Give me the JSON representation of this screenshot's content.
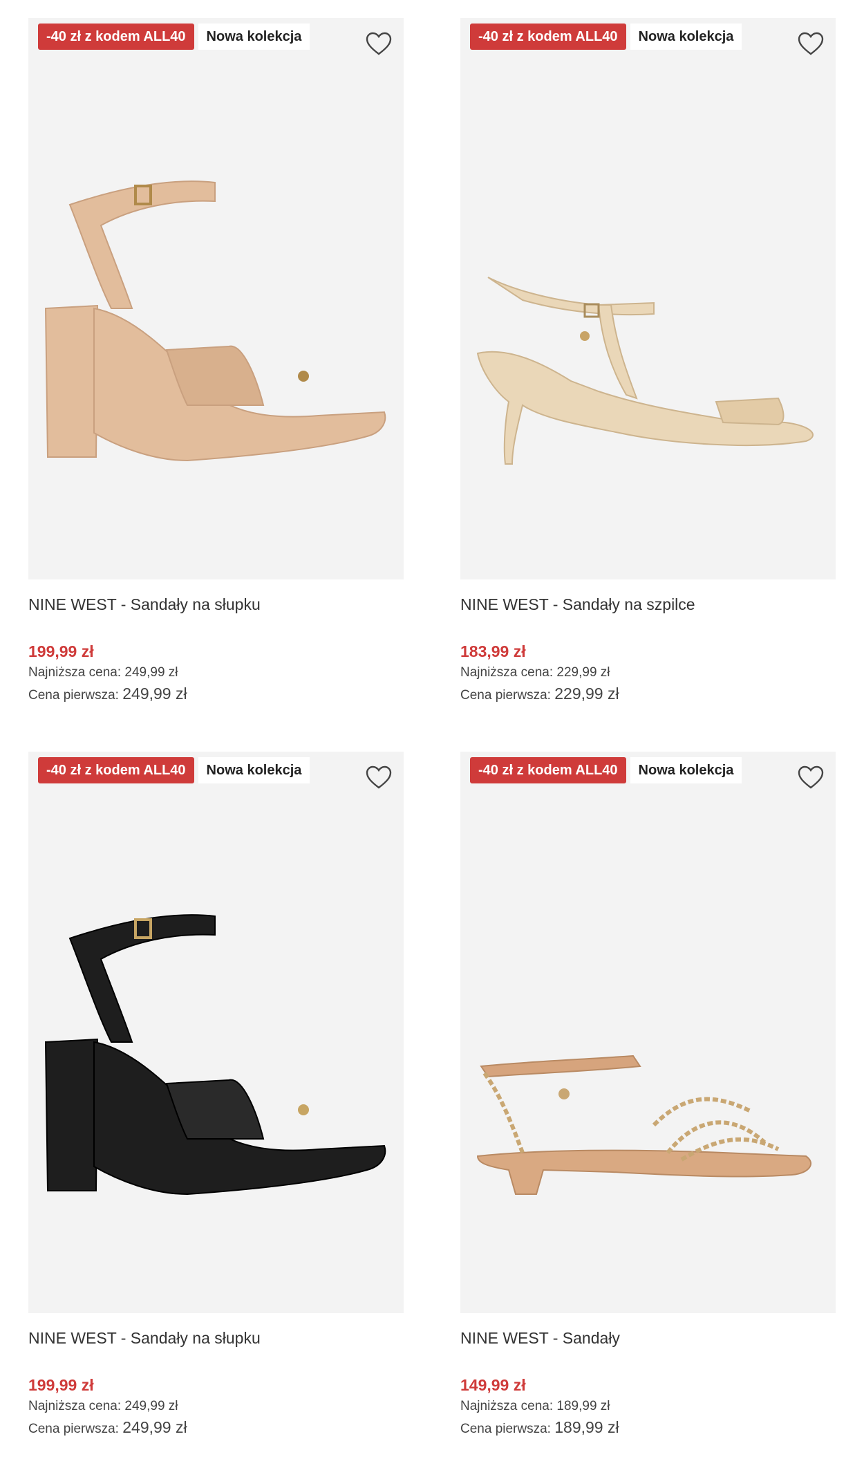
{
  "products": [
    {
      "promo_badge": "-40 zł z kodem ALL40",
      "new_badge": "Nowa kolekcja",
      "title": "NINE WEST - Sandały na słupku",
      "price": "199,99 zł",
      "lowest_label": "Najniższa cena:",
      "lowest_value": "249,99 zł",
      "first_label": "Cena pierwsza:",
      "first_value": "249,99 zł",
      "shoe_color": "#e2bd9c"
    },
    {
      "promo_badge": "-40 zł z kodem ALL40",
      "new_badge": "Nowa kolekcja",
      "title": "NINE WEST - Sandały na szpilce",
      "price": "183,99 zł",
      "lowest_label": "Najniższa cena:",
      "lowest_value": "229,99 zł",
      "first_label": "Cena pierwsza:",
      "first_value": "229,99 zł",
      "shoe_color": "#ead7b8"
    },
    {
      "promo_badge": "-40 zł z kodem ALL40",
      "new_badge": "Nowa kolekcja",
      "title": "NINE WEST - Sandały na słupku",
      "price": "199,99 zł",
      "lowest_label": "Najniższa cena:",
      "lowest_value": "249,99 zł",
      "first_label": "Cena pierwsza:",
      "first_value": "249,99 zł",
      "shoe_color": "#1e1e1e"
    },
    {
      "promo_badge": "-40 zł z kodem ALL40",
      "new_badge": "Nowa kolekcja",
      "title": "NINE WEST - Sandały",
      "price": "149,99 zł",
      "lowest_label": "Najniższa cena:",
      "lowest_value": "189,99 zł",
      "first_label": "Cena pierwsza:",
      "first_value": "189,99 zł",
      "shoe_color": "#d9a982"
    }
  ],
  "icons": {
    "wishlist": "heart-outline-icon"
  },
  "colors": {
    "promo": "#cf3b3a",
    "price": "#cf3b3a",
    "image_bg": "#f3f3f3"
  }
}
